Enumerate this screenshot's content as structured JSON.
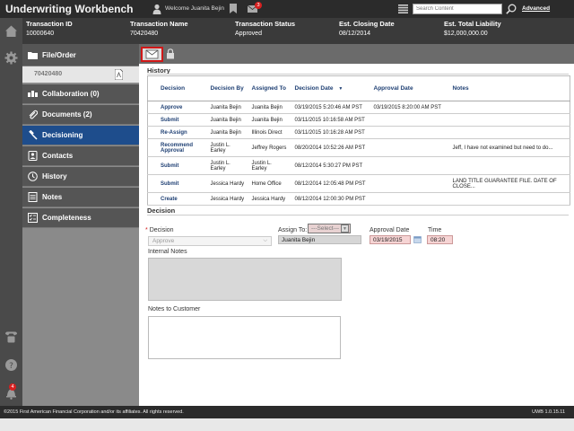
{
  "app": {
    "title": "Underwriting Workbench",
    "welcome": "Welcome Juanita Bejin",
    "mail_count": "3",
    "search_placeholder": "Search Content",
    "advanced_label": "Advanced"
  },
  "summary": [
    {
      "label": "Transaction ID",
      "value": "10000640"
    },
    {
      "label": "Transaction Name",
      "value": "70420480"
    },
    {
      "label": "Transaction Status",
      "value": "Approved"
    },
    {
      "label": "Est. Closing Date",
      "value": "08/12/2014"
    },
    {
      "label": "Est. Total Liability",
      "value": "$12,000,000.00"
    }
  ],
  "rail": {
    "alert_count": "4"
  },
  "nav": {
    "file_order": "File/Order",
    "order_number": "70420480",
    "items": [
      {
        "label": "Collaboration (0)"
      },
      {
        "label": "Documents (2)"
      },
      {
        "label": "Decisioning"
      },
      {
        "label": "Contacts"
      },
      {
        "label": "History"
      },
      {
        "label": "Notes"
      },
      {
        "label": "Completeness"
      }
    ]
  },
  "history": {
    "title": "History",
    "columns": [
      "Decision",
      "Decision By",
      "Assigned To",
      "Decision Date",
      "Approval Date",
      "Notes"
    ],
    "rows": [
      {
        "decision": "Approve",
        "by": "Juanita Bejin",
        "to": "Juanita Bejin",
        "date": "03/19/2015 5:20:46 AM PST",
        "approval": "03/19/2015 8:20:00 AM PST",
        "notes": ""
      },
      {
        "decision": "Submit",
        "by": "Juanita Bejin",
        "to": "Juanita Bejin",
        "date": "03/11/2015 10:16:58 AM PST",
        "approval": "",
        "notes": ""
      },
      {
        "decision": "Re-Assign",
        "by": "Juanita Bejin",
        "to": "Illinois Direct",
        "date": "03/11/2015 10:16:28 AM PST",
        "approval": "",
        "notes": ""
      },
      {
        "decision": "Recommend Approval",
        "by": "Justin L. Earley",
        "to": "Jeffrey Rogers",
        "date": "08/20/2014 10:52:26 AM PST",
        "approval": "",
        "notes": "Jeff, I have not examined but need to do..."
      },
      {
        "decision": "Submit",
        "by": "Justin L. Earley",
        "to": "Justin L. Earley",
        "date": "08/12/2014 5:30:27 PM PST",
        "approval": "",
        "notes": ""
      },
      {
        "decision": "Submit",
        "by": "Jessica Hardy",
        "to": "Home Office",
        "date": "08/12/2014 12:05:48 PM PST",
        "approval": "",
        "notes": "LAND TITLE GUARANTEE FILE. DATE OF CLOSE..."
      },
      {
        "decision": "Create",
        "by": "Jessica Hardy",
        "to": "Jessica Hardy",
        "date": "08/12/2014 12:00:30 PM PST",
        "approval": "",
        "notes": ""
      }
    ]
  },
  "decision_form": {
    "title": "Decision",
    "decision_label": "Decision",
    "decision_value": "Approve",
    "assign_label": "Assign To:",
    "assign_select": "---Select---",
    "assign_value": "Juanita Bejin",
    "approval_date_label": "Approval Date",
    "approval_date_value": "03/19/2015",
    "time_label": "Time",
    "time_value": "08:20",
    "internal_notes_label": "Internal Notes",
    "customer_notes_label": "Notes to Customer"
  },
  "footer": {
    "copyright": "©2015 First American Financial Corporation and/or its affiliates. All rights reserved.",
    "version": "UWB 1.0.15.11"
  },
  "colors": {
    "topbar": "#2b2b2b",
    "active_nav": "#1e4d8c",
    "link_blue": "#1e3f73",
    "badge_red": "#d72020"
  }
}
